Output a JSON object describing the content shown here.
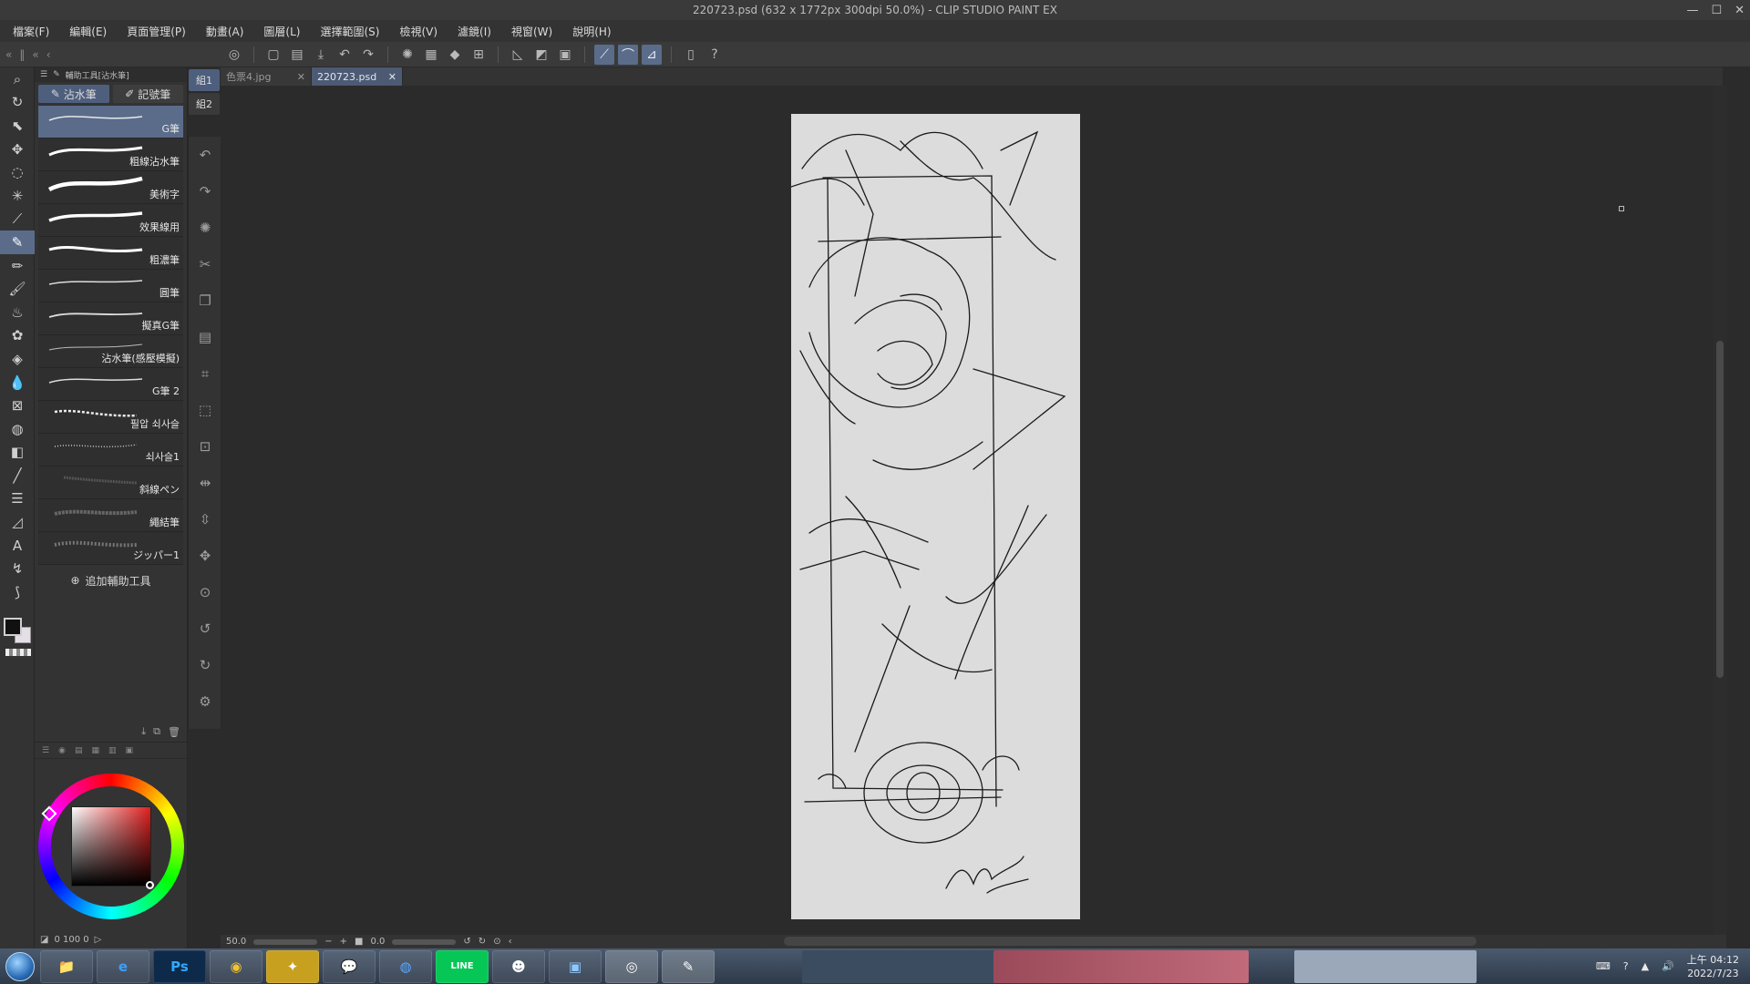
{
  "window": {
    "title": "220723.psd (632 x 1772px 300dpi 50.0%)  - CLIP STUDIO PAINT EX"
  },
  "menu": [
    "檔案(F)",
    "編輯(E)",
    "頁面管理(P)",
    "動畫(A)",
    "圖層(L)",
    "選擇範圍(S)",
    "檢視(V)",
    "濾鏡(I)",
    "視窗(W)",
    "說明(H)"
  ],
  "subtool_panel": {
    "header": "輔助工具[沾水筆]",
    "groups": [
      {
        "label": "沾水筆",
        "active": true
      },
      {
        "label": "記號筆",
        "active": false
      }
    ],
    "brushes": [
      {
        "name": "G筆",
        "active": true
      },
      {
        "name": "粗線沾水筆",
        "active": false
      },
      {
        "name": "美術字",
        "active": false
      },
      {
        "name": "效果線用",
        "active": false
      },
      {
        "name": "粗濃筆",
        "active": false
      },
      {
        "name": "圓筆",
        "active": false
      },
      {
        "name": "擬真G筆",
        "active": false
      },
      {
        "name": "沾水筆(感壓模擬)",
        "active": false
      },
      {
        "name": "G筆 2",
        "active": false
      },
      {
        "name": "필압 쇠사슬",
        "active": false
      },
      {
        "name": "쇠사슬1",
        "active": false
      },
      {
        "name": "斜線ペン",
        "active": false
      },
      {
        "name": "繩結筆",
        "active": false
      },
      {
        "name": "ジッパー1",
        "active": false
      }
    ],
    "add_label": "追加輔助工具"
  },
  "set_tabs": [
    "組1",
    "組2"
  ],
  "documents": [
    {
      "name": "色票4.jpg",
      "active": false
    },
    {
      "name": "220723.psd",
      "active": true
    }
  ],
  "color_panel": {
    "footer": "0  100  0"
  },
  "status": {
    "zoom": "50.0",
    "rotation": "0.0"
  },
  "taskbar": {
    "apps": [
      {
        "name": "file-explorer",
        "glyph": "📁"
      },
      {
        "name": "internet-explorer",
        "glyph": "e"
      },
      {
        "name": "photoshop",
        "glyph": "Ps"
      },
      {
        "name": "chrome",
        "glyph": "◉"
      },
      {
        "name": "paint-app",
        "glyph": "✦"
      },
      {
        "name": "wechat",
        "glyph": "💬"
      },
      {
        "name": "app-blue",
        "glyph": "◍"
      },
      {
        "name": "line",
        "glyph": "LINE"
      },
      {
        "name": "anime-app",
        "glyph": "☻"
      },
      {
        "name": "photo-viewer",
        "glyph": "▣"
      },
      {
        "name": "clip-studio",
        "glyph": "◎"
      },
      {
        "name": "clip-studio-paint",
        "glyph": "✎"
      }
    ],
    "clock_time": "上午 04:12",
    "clock_date": "2022/7/23"
  },
  "colors": {
    "accent": "#5a6c8a",
    "panel": "#333333",
    "canvas_bg": "#2b2b2b",
    "paper": "#dcdcdc"
  }
}
